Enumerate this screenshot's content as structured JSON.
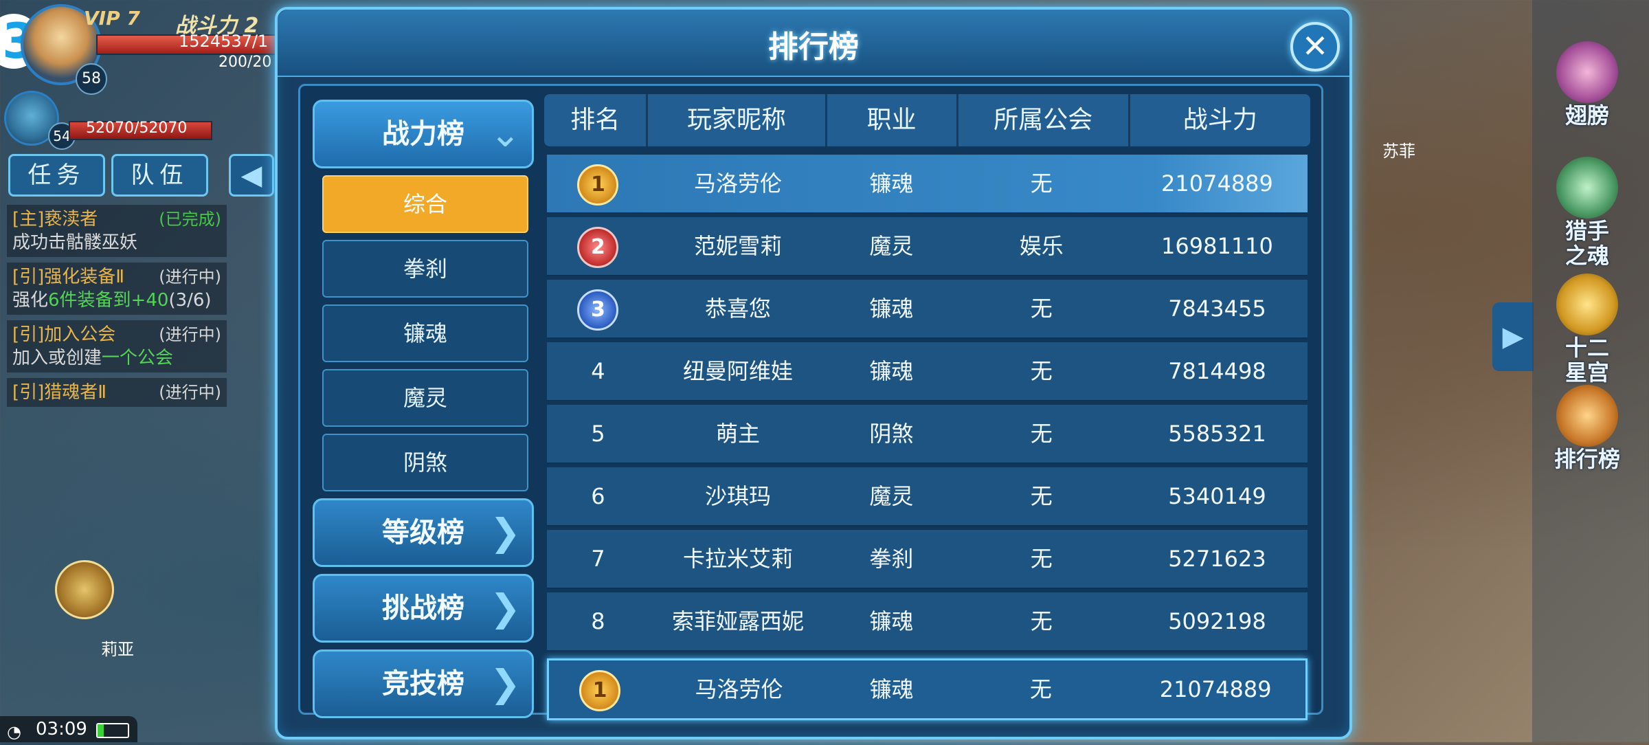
{
  "hud": {
    "vip": "VIP 7",
    "power_label": "战斗力 2",
    "hp_text": "1524537/1",
    "mp_text": "200/20",
    "level": "58",
    "pet_level": "54",
    "pet_hp_text": "52070/52070",
    "tab_task": "任务",
    "tab_team": "队伍",
    "npc_left": "莉亚",
    "npc_right": "苏菲",
    "time": "03:09",
    "quests": [
      {
        "title": "[主]亵渎者",
        "status": "(已完成)",
        "desc": "成功击骷髅巫妖",
        "desc_green": ""
      },
      {
        "title": "[引]强化装备Ⅱ",
        "status": "(进行中)",
        "desc": "强化",
        "desc_green": "6件装备到+40",
        "desc_tail": "(3/6)"
      },
      {
        "title": "[引]加入公会",
        "status": "(进行中)",
        "desc": "加入或创建",
        "desc_green": "一个公会"
      },
      {
        "title": "[引]猎魂者Ⅱ",
        "status": "(进行中)",
        "desc": "",
        "desc_green": ""
      }
    ],
    "side_items": [
      "翅膀",
      "猎手之魂",
      "十二星宫",
      "排行榜"
    ]
  },
  "panel": {
    "title": "排行榜",
    "categories": {
      "power": "战力榜",
      "level": "等级榜",
      "challenge": "挑战榜",
      "arena": "竞技榜"
    },
    "subcategories": [
      "综合",
      "拳刹",
      "镰魂",
      "魔灵",
      "阴煞"
    ],
    "columns": [
      "排名",
      "玩家昵称",
      "职业",
      "所属公会",
      "战斗力"
    ],
    "rows": [
      {
        "rank": "1",
        "name": "马洛劳伦",
        "class": "镰魂",
        "guild": "无",
        "power": "21074889"
      },
      {
        "rank": "2",
        "name": "范妮雪莉",
        "class": "魔灵",
        "guild": "娱乐",
        "power": "16981110"
      },
      {
        "rank": "3",
        "name": "恭喜您",
        "class": "镰魂",
        "guild": "无",
        "power": "7843455"
      },
      {
        "rank": "4",
        "name": "纽曼阿维娃",
        "class": "镰魂",
        "guild": "无",
        "power": "7814498"
      },
      {
        "rank": "5",
        "name": "萌主",
        "class": "阴煞",
        "guild": "无",
        "power": "5585321"
      },
      {
        "rank": "6",
        "name": "沙琪玛",
        "class": "魔灵",
        "guild": "无",
        "power": "5340149"
      },
      {
        "rank": "7",
        "name": "卡拉米艾莉",
        "class": "拳刹",
        "guild": "无",
        "power": "5271623"
      },
      {
        "rank": "8",
        "name": "索菲娅露西妮",
        "class": "镰魂",
        "guild": "无",
        "power": "5092198"
      }
    ],
    "my_row": {
      "rank": "1",
      "name": "马洛劳伦",
      "class": "镰魂",
      "guild": "无",
      "power": "21074889"
    }
  }
}
